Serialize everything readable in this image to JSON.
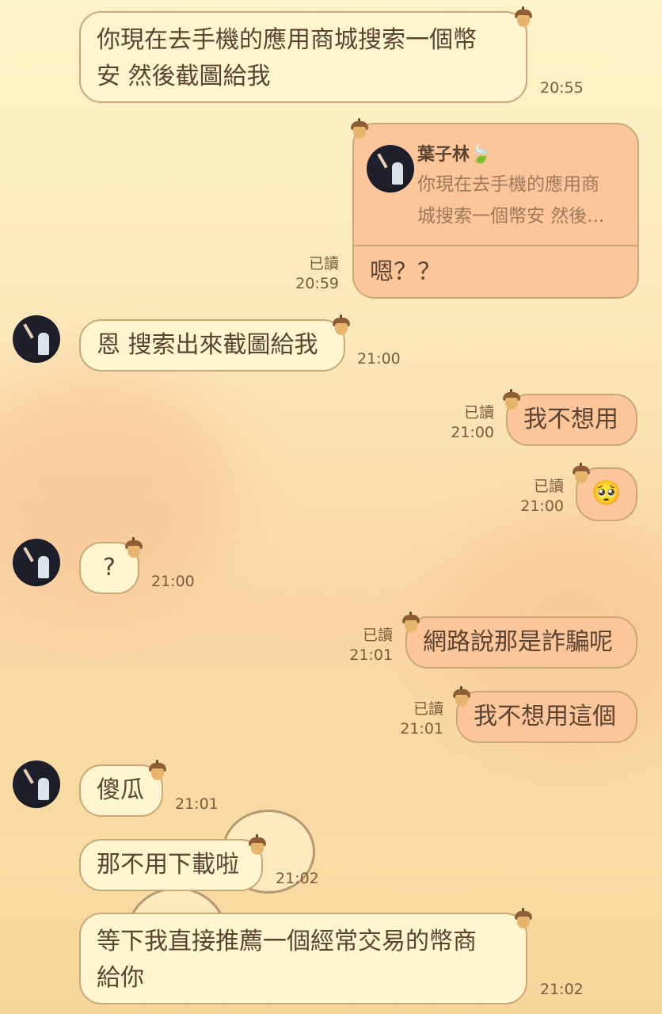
{
  "messages": [
    {
      "id": "m1",
      "side": "in",
      "lines": [
        "你現在去手機的應用商城搜索一個幣",
        "安 然後截圖給我"
      ],
      "time": "20:55"
    },
    {
      "id": "m2",
      "side": "out",
      "reply": {
        "author": "葉子林",
        "preview_lines": [
          "你現在去手機的應用商",
          "城搜索一個幣安 然後..."
        ]
      },
      "text": "嗯？？",
      "read": "已讀",
      "time": "20:59"
    },
    {
      "id": "m3",
      "side": "in",
      "text": "恩 搜索出來截圖給我",
      "time": "21:00"
    },
    {
      "id": "m4",
      "side": "out",
      "text": "我不想用",
      "read": "已讀",
      "time": "21:00"
    },
    {
      "id": "m5",
      "side": "out",
      "text": "🥺",
      "read": "已讀",
      "time": "21:00"
    },
    {
      "id": "m6",
      "side": "in",
      "text": "?",
      "time": "21:00"
    },
    {
      "id": "m7",
      "side": "out",
      "text": "網路說那是詐騙呢",
      "read": "已讀",
      "time": "21:01"
    },
    {
      "id": "m8",
      "side": "out",
      "text": "我不想用這個",
      "read": "已讀",
      "time": "21:01"
    },
    {
      "id": "m9",
      "side": "in",
      "text": "傻瓜",
      "time": "21:01"
    },
    {
      "id": "m10",
      "side": "in",
      "text": "那不用下載啦",
      "time": "21:02"
    },
    {
      "id": "m11",
      "side": "in",
      "lines": [
        "等下我直接推薦一個經常交易的幣商",
        "給你"
      ],
      "time": "21:02"
    }
  ],
  "icons": {
    "bubble_corner": "acorn-icon",
    "reply_author_emoji": "leaf-icon",
    "avatar": "contact-avatar"
  },
  "colors": {
    "incoming_bubble": "#fff6cf",
    "outgoing_bubble": "#fcc59a",
    "bubble_border": "#c9a878",
    "text": "#5b4330"
  }
}
